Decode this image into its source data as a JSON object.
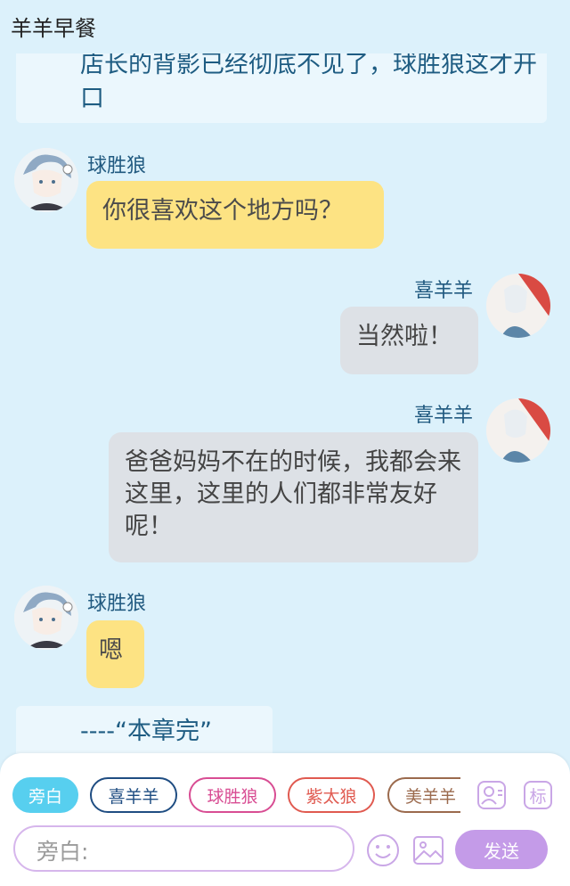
{
  "header": {
    "title": "羊羊早餐"
  },
  "messages": {
    "narration_top": "店长的背影已经彻底不见了，球胜狼这才开口",
    "m1": {
      "speaker": "球胜狼",
      "text": "你很喜欢这个地方吗？"
    },
    "m2": {
      "speaker": "喜羊羊",
      "text": "当然啦！"
    },
    "m3": {
      "speaker": "喜羊羊",
      "text": "爸爸妈妈不在的时候，我都会来这里，这里的人们都非常友好呢！"
    },
    "m4": {
      "speaker": "球胜狼",
      "text": "嗯"
    },
    "narration_end": "----“本章完”"
  },
  "composer": {
    "roles": [
      "旁白",
      "喜羊羊",
      "球胜狼",
      "紫太狼",
      "美羊羊"
    ],
    "role_colors": [
      "#57cfef",
      "#1f4d82",
      "#d84d93",
      "#e05a50",
      "#9b6a4d"
    ],
    "icons": [
      "contact-card-icon",
      "tag-icon",
      "emoji-icon",
      "image-icon"
    ],
    "tag_label": "标",
    "input_placeholder": "旁白:",
    "send_label": "发送"
  }
}
